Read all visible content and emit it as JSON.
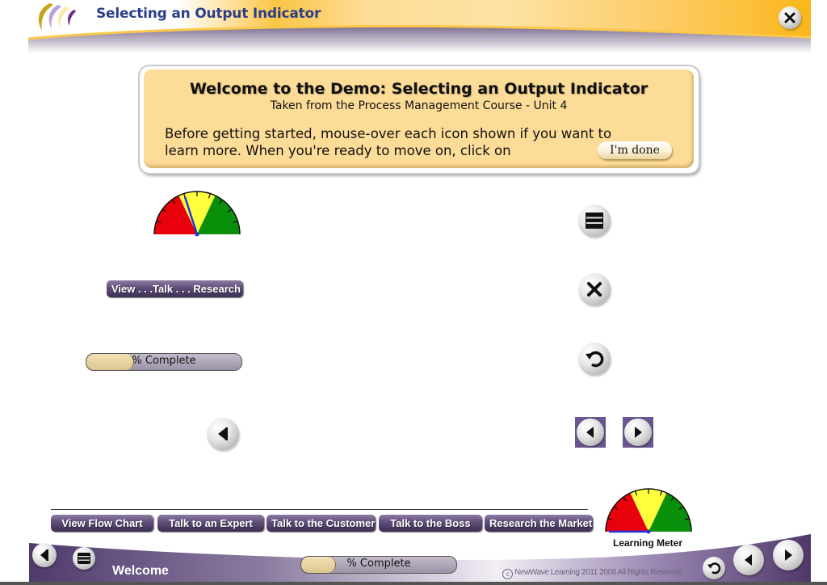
{
  "header": {
    "title": "Selecting an Output Indicator",
    "logo_icon": "crescent-arcs-logo",
    "close_icon": "close-icon"
  },
  "welcome_panel": {
    "title": "Welcome to the Demo: Selecting an Output Indicator",
    "subtitle": "Taken from the Process Management Course - Unit 4",
    "body": "Before getting started, mouse-over each icon shown if you want to learn more.  When you're ready to move on, click on",
    "done_button": "I'm done"
  },
  "demo_icons": {
    "left": {
      "gauge": {
        "icon": "gauge-icon",
        "needle_position": 0.4
      },
      "view_talk_research_button": "View . . .Talk . . . Research",
      "progress": {
        "label": "% Complete",
        "value_percent": 30
      },
      "back_icon": "back-arrow-icon"
    },
    "right": {
      "menu_icon": "menu-icon",
      "close_icon": "close-icon",
      "replay_icon": "replay-icon",
      "prev_icon": "previous-icon",
      "next_icon": "next-icon"
    }
  },
  "bottom_nav": {
    "buttons": [
      {
        "label": "View Flow Chart"
      },
      {
        "label": "Talk to an Expert"
      },
      {
        "label": "Talk to the Customer"
      },
      {
        "label": "Talk to the Boss"
      },
      {
        "label": "Research the Market"
      }
    ],
    "progress": {
      "label": "% Complete",
      "value_percent": 22
    },
    "learning_meter": {
      "label": "Learning Meter",
      "needle_position": 0.0
    }
  },
  "footer": {
    "title": "Welcome",
    "copyright": "NewWave Learning 2011 2008 All Rights Reserved",
    "copyright_mark": "c"
  },
  "colors": {
    "title_blue": "#2b3f8a",
    "accent_orange": "#fbb81c",
    "accent_purple": "#5a4478",
    "panel_yellow": "#fddc98",
    "gauge_red": "#e8000a",
    "gauge_yellow": "#ffff3c",
    "gauge_green": "#0a8f0a",
    "needle_blue": "#2233dd"
  }
}
